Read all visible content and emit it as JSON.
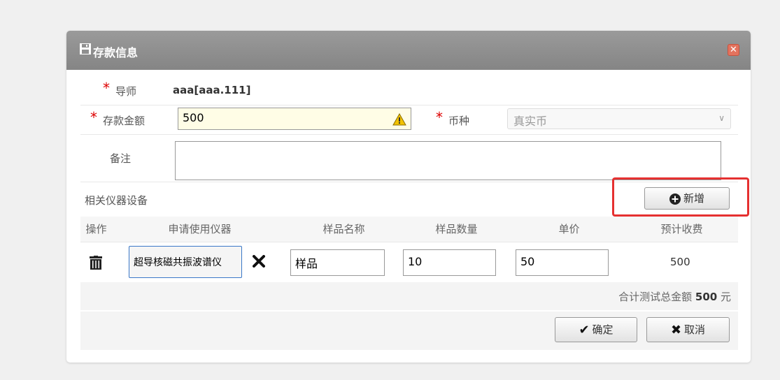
{
  "dialog": {
    "title": "存款信息",
    "close_symbol": "✕"
  },
  "form": {
    "tutor_label": "导师",
    "tutor_value": "aaa[aaa.111]",
    "amount_label": "存款金额",
    "amount_value": "500",
    "currency_label": "币种",
    "currency_value": "真实币",
    "remark_label": "备注",
    "remark_value": "",
    "required_mark": "*"
  },
  "equipment": {
    "section_label": "相关仪器设备",
    "add_button_label": "新增",
    "columns": [
      "操作",
      "申请使用仪器",
      "样品名称",
      "样品数量",
      "单价",
      "预计收费"
    ],
    "rows": [
      {
        "instrument": "超导核磁共振波谱仪",
        "sample_name": "样品",
        "sample_qty": "10",
        "unit_price": "50",
        "estimated_fee": "500"
      }
    ],
    "total_prefix": "合计测试总金额",
    "total_value": "500",
    "total_unit": "元"
  },
  "footer": {
    "confirm_label": "确定",
    "cancel_label": "取消"
  },
  "colors": {
    "titlebar": "#8f8f8f",
    "required": "#dd0000",
    "highlight": "#e53030",
    "amount_bg": "#fffde6"
  }
}
